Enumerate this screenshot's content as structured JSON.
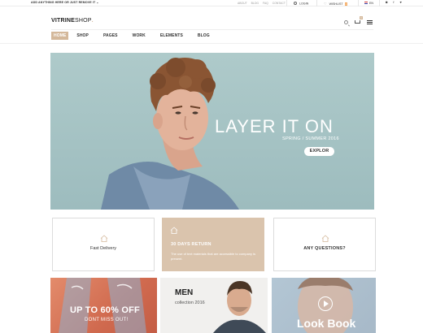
{
  "topbar": {
    "promo": "ADD ANYTHING HERE OR JUST REMOVE IT ⌄",
    "links": [
      "ABOUT",
      "BLOG",
      "FAQ",
      "CONTACT"
    ],
    "login": "LOGIN",
    "wishlist": "WISHLIST",
    "wishlist_count": "0",
    "language": "EN",
    "social_icons": [
      "instagram-icon",
      "facebook-icon",
      "twitter-icon"
    ],
    "social_glyphs": "◙ f ♥"
  },
  "header": {
    "logo_main": "VITRINE",
    "logo_shop": "SHOP",
    "logo_dot": ".",
    "cart_count": "0"
  },
  "nav": {
    "items": [
      "HOME",
      "SHOP",
      "PAGES",
      "WORK",
      "ELEMENTS",
      "BLOG"
    ],
    "active": "HOME"
  },
  "hero": {
    "title": "LAYER IT ON",
    "subtitle": "SPRING / SUMMER 2016",
    "cta": "EXPLOR"
  },
  "features": [
    {
      "label": "Fast Delivery",
      "icon": "home-icon"
    },
    {
      "label": "30 DAYS RETURN",
      "desc": "The use of text materials that are accessible to company is present.",
      "icon": "home-icon"
    },
    {
      "label": "ANY QUESTIONS?",
      "icon": "home-icon"
    }
  ],
  "tiles": [
    {
      "big": "UP TO 60% OFF",
      "small": "DONT MISS OUT!"
    },
    {
      "big": "MEN",
      "small": "collection 2016"
    },
    {
      "big": "Look Book",
      "icon": "play-icon"
    }
  ],
  "colors": {
    "accent": "#d4b89a",
    "hero_bg": "#aecaca",
    "feature_highlight": "#dac4ad",
    "tile_sale": "#d06a4f"
  }
}
